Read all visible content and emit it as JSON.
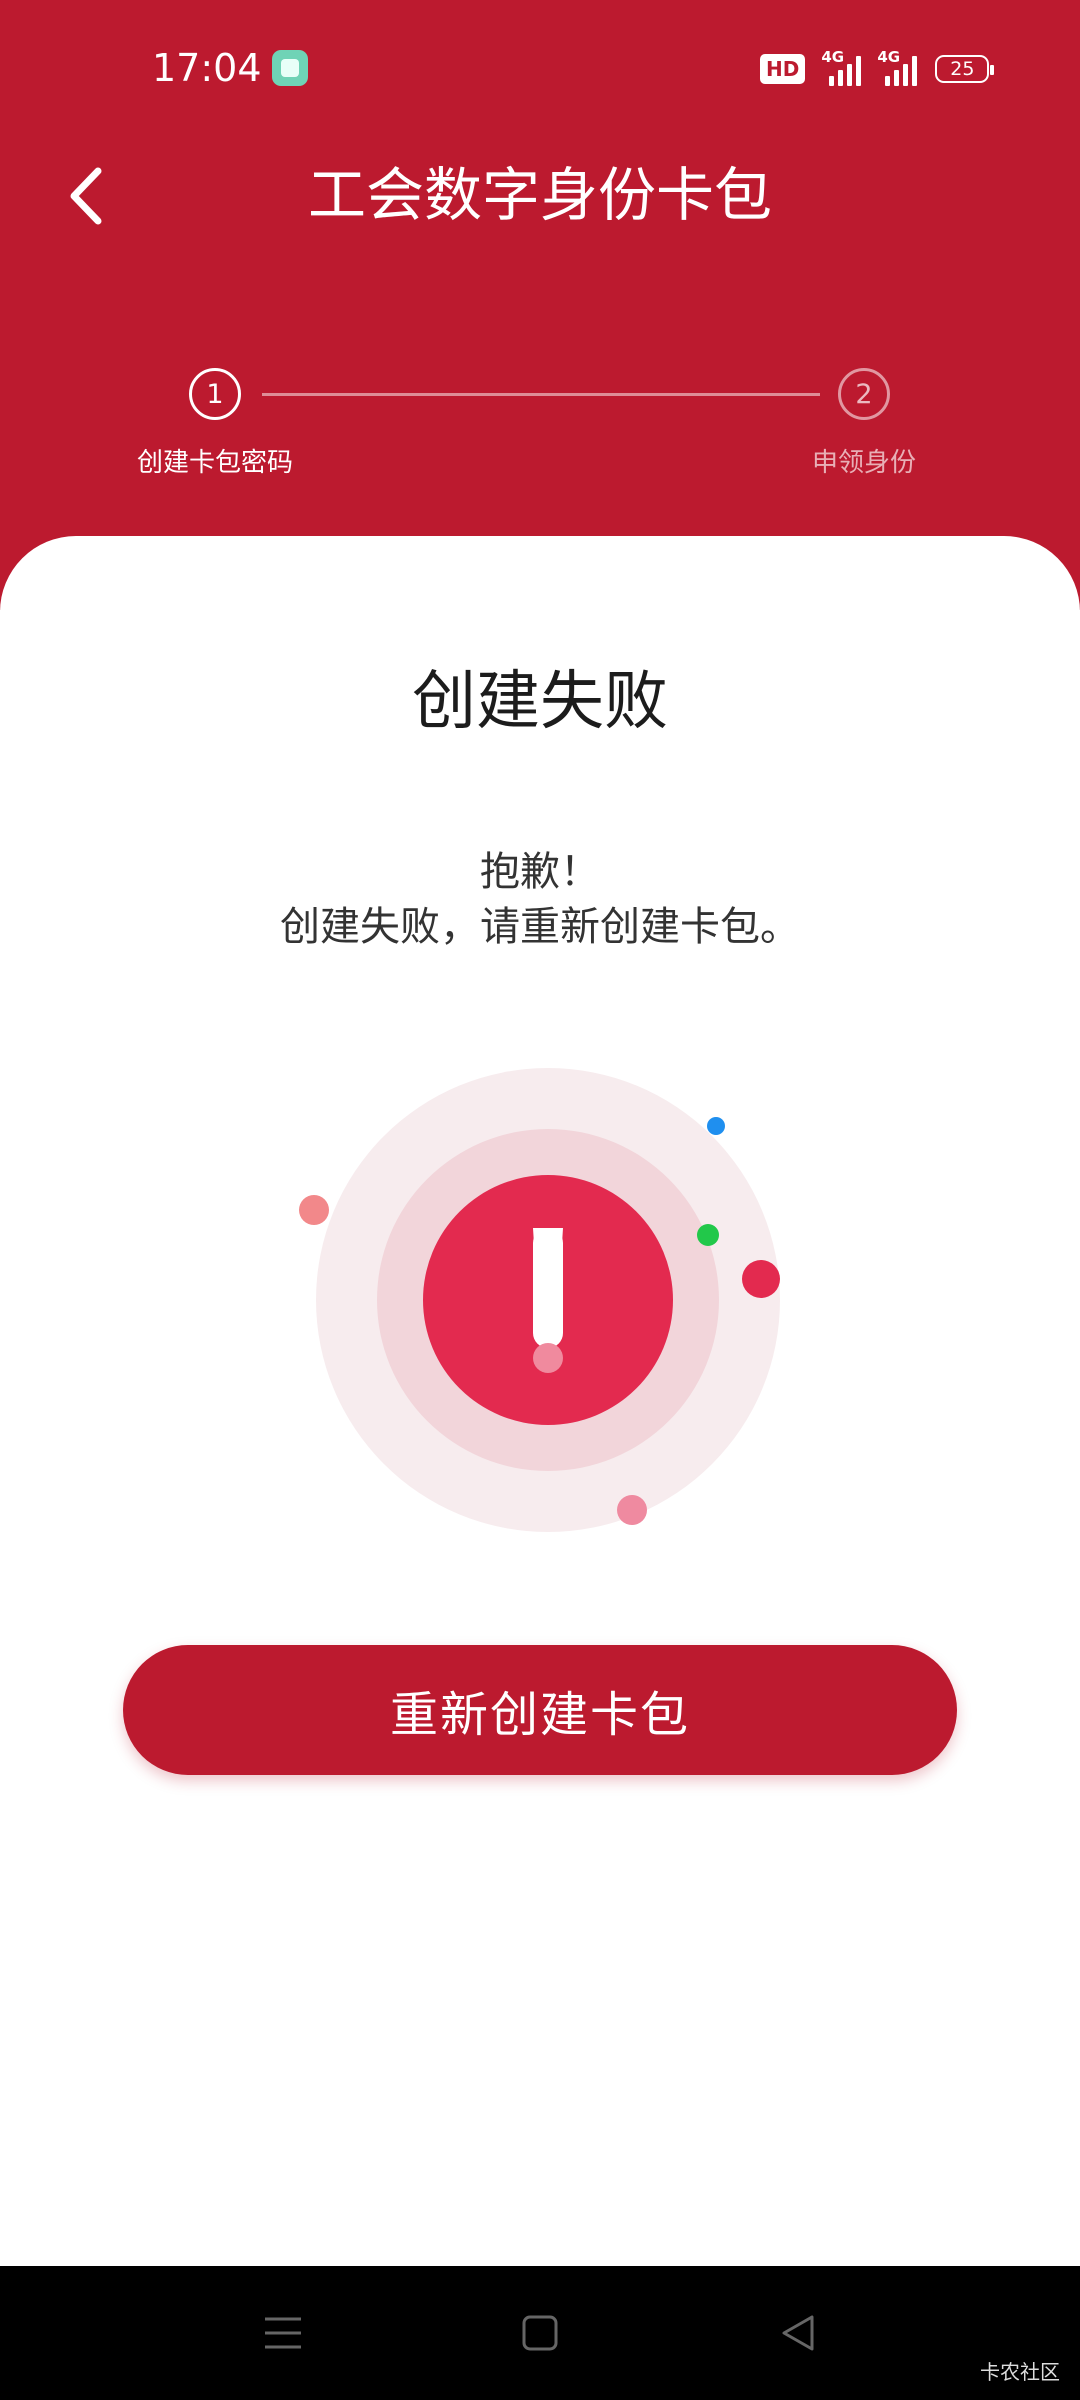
{
  "status_bar": {
    "time": "17:04",
    "hd_label": "HD",
    "network_1": "4G",
    "network_2": "4G",
    "battery": "25"
  },
  "header": {
    "title": "工会数字身份卡包",
    "back_icon": "chevron-left-icon",
    "background_color": "#bc1a2f"
  },
  "stepper": {
    "steps": [
      {
        "number": "1",
        "label": "创建卡包密码",
        "active": true
      },
      {
        "number": "2",
        "label": "申领身份",
        "active": false
      }
    ]
  },
  "result": {
    "title": "创建失败",
    "message_line1": "抱歉！",
    "message_line2": "创建失败，请重新创建卡包。",
    "icon": "exclamation-alert-icon"
  },
  "actions": {
    "retry_label": "重新创建卡包"
  },
  "nav_bar": {
    "menu_icon": "menu-icon",
    "home_icon": "home-square-icon",
    "back_icon": "back-triangle-icon"
  },
  "watermark": "卡农社区"
}
